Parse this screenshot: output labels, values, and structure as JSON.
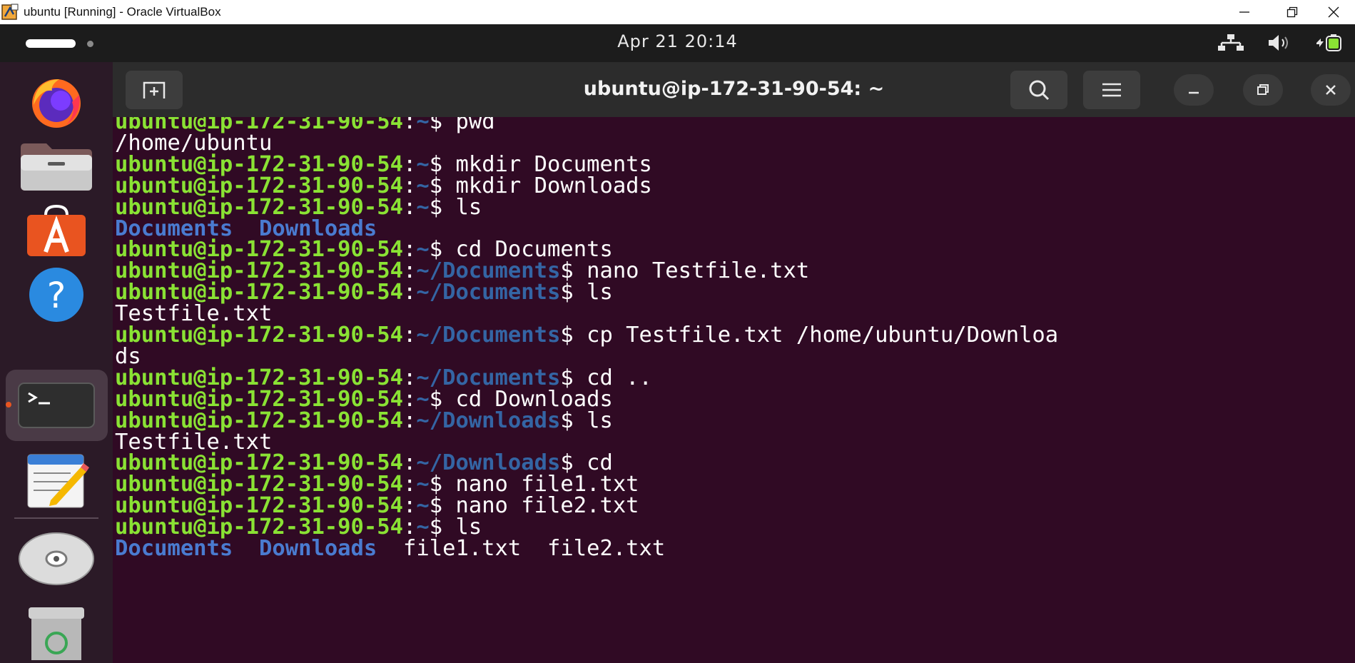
{
  "host_window": {
    "title": "ubuntu [Running] - Oracle VirtualBox"
  },
  "top_bar": {
    "clock": "Apr 21  20:14"
  },
  "dock": {
    "items": [
      "firefox",
      "files",
      "app-center",
      "help",
      "terminal",
      "text-editor",
      "disc",
      "trash"
    ],
    "active": "terminal"
  },
  "terminal": {
    "title": "ubuntu@ip-172-31-90-54: ~",
    "prompt_user": "ubuntu@ip-172-31-90-54",
    "lines": [
      {
        "type": "prompt",
        "path": "~",
        "cmd": "pwd"
      },
      {
        "type": "output",
        "text": "/home/ubuntu"
      },
      {
        "type": "prompt",
        "path": "~",
        "cmd": "mkdir Documents"
      },
      {
        "type": "prompt",
        "path": "~",
        "cmd": "mkdir Downloads"
      },
      {
        "type": "prompt",
        "path": "~",
        "cmd": "ls"
      },
      {
        "type": "listing",
        "entries": [
          {
            "name": "Documents",
            "kind": "dir"
          },
          {
            "name": "Downloads",
            "kind": "dir"
          }
        ]
      },
      {
        "type": "prompt",
        "path": "~",
        "cmd": "cd Documents"
      },
      {
        "type": "prompt",
        "path": "~/Documents",
        "cmd": "nano Testfile.txt"
      },
      {
        "type": "prompt",
        "path": "~/Documents",
        "cmd": "ls"
      },
      {
        "type": "output",
        "text": "Testfile.txt"
      },
      {
        "type": "prompt",
        "path": "~/Documents",
        "cmd": "cp Testfile.txt /home/ubuntu/Downloa"
      },
      {
        "type": "output",
        "text": "ds"
      },
      {
        "type": "prompt",
        "path": "~/Documents",
        "cmd": "cd .."
      },
      {
        "type": "prompt",
        "path": "~",
        "cmd": "cd Downloads"
      },
      {
        "type": "prompt",
        "path": "~/Downloads",
        "cmd": "ls"
      },
      {
        "type": "output",
        "text": "Testfile.txt"
      },
      {
        "type": "prompt",
        "path": "~/Downloads",
        "cmd": "cd"
      },
      {
        "type": "prompt",
        "path": "~",
        "cmd": "nano file1.txt"
      },
      {
        "type": "prompt",
        "path": "~",
        "cmd": "nano file2.txt"
      },
      {
        "type": "prompt",
        "path": "~",
        "cmd": "ls"
      },
      {
        "type": "listing",
        "entries": [
          {
            "name": "Documents",
            "kind": "dir"
          },
          {
            "name": "Downloads",
            "kind": "dir"
          },
          {
            "name": "file1.txt",
            "kind": "file"
          },
          {
            "name": "file2.txt",
            "kind": "file"
          }
        ]
      }
    ]
  },
  "colors": {
    "terminal_bg": "#300a24",
    "prompt_user": "#8ae234",
    "prompt_path": "#3465a4",
    "dock_bg": "#2b1a27",
    "accent": "#e95420"
  }
}
